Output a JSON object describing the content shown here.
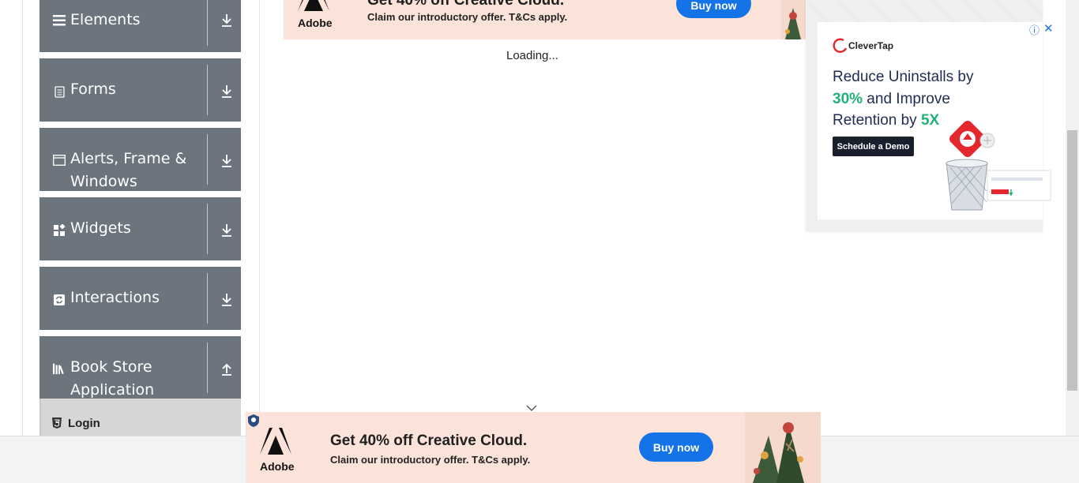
{
  "sidebar": {
    "groups": [
      {
        "title": "Elements",
        "icon": "hamburger-icon",
        "toggle": "download-arrow-icon"
      },
      {
        "title": "Forms",
        "icon": "document-icon",
        "toggle": "download-arrow-icon"
      },
      {
        "title": "Alerts, Frame & Windows",
        "icon": "window-icon",
        "toggle": "download-arrow-icon"
      },
      {
        "title": "Widgets",
        "icon": "widgets-icon",
        "toggle": "download-arrow-icon"
      },
      {
        "title": "Interactions",
        "icon": "refresh-icon",
        "toggle": "download-arrow-icon"
      },
      {
        "title": "Book Store Application",
        "icon": "library-icon",
        "toggle": "upload-arrow-icon"
      }
    ],
    "submenu_item": {
      "label": "Login",
      "icon": "html5-icon"
    }
  },
  "main": {
    "loading_text": "Loading..."
  },
  "ads": {
    "top_banner": {
      "brand": "Adobe",
      "headline": "Get 40% off Creative Cloud.",
      "subline": "Claim our introductory offer. T&Cs apply.",
      "button": "Buy now"
    },
    "side_ad": {
      "brand": "CleverTap",
      "headline_1": "Reduce Uninstalls by",
      "highlight_1": "30%",
      "headline_2": " and Improve Retention by ",
      "highlight_2": "5X",
      "cta": "Schedule a Demo",
      "info_icon": "ⓘ",
      "close_icon": "✕"
    },
    "bottom_banner": {
      "brand": "Adobe",
      "headline": "Get 40% off Creative Cloud.",
      "subline": "Claim our introductory offer. T&Cs apply.",
      "button": "Buy now"
    }
  },
  "colors": {
    "sidebar_group_bg": "#6c757d",
    "ad_bg": "#fbe3da",
    "buy_button": "#1473e6",
    "clevertap_red": "#e4262d",
    "clevertap_green": "#1fb37a"
  }
}
